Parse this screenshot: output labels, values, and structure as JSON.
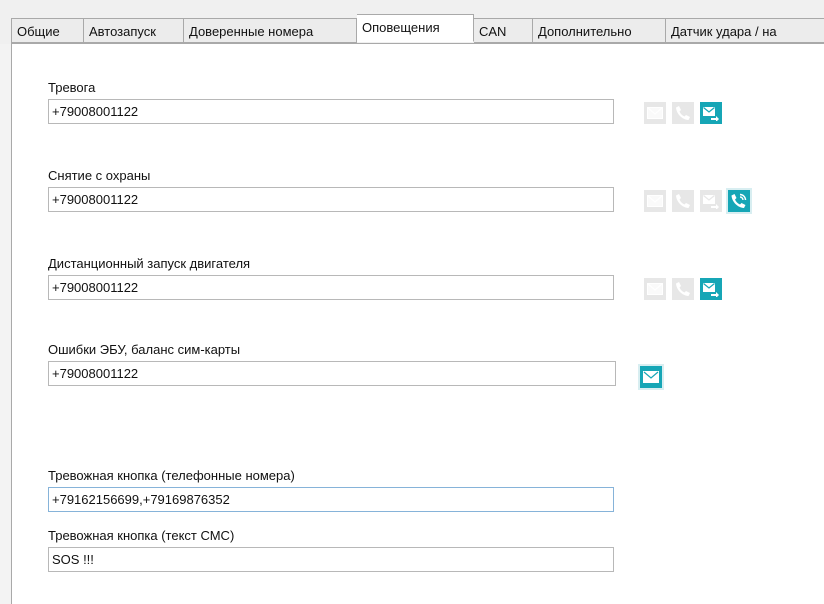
{
  "tabs": [
    {
      "label": "Общие"
    },
    {
      "label": "Автозапуск"
    },
    {
      "label": "Доверенные номера"
    },
    {
      "label": "Оповещения",
      "active": true
    },
    {
      "label": "CAN"
    },
    {
      "label": "Дополнительно"
    },
    {
      "label": "Датчик удара / на"
    }
  ],
  "alerts": [
    {
      "label": "Тревога",
      "value": "+79008001122",
      "icons": [
        "sms-off",
        "call-off",
        "forward-on"
      ]
    },
    {
      "label": "Снятие с охраны",
      "value": "+79008001122",
      "icons": [
        "sms-off",
        "call-off",
        "forward-off",
        "call-ring-on"
      ]
    },
    {
      "label": "Дистанционный запуск двигателя",
      "value": "+79008001122",
      "icons": [
        "sms-off",
        "call-off",
        "forward-on"
      ]
    },
    {
      "label": "Ошибки ЭБУ, баланс сим-карты",
      "value": "+79008001122",
      "icons": [
        "sms-on"
      ]
    }
  ],
  "panic": {
    "phones_label": "Тревожная кнопка (телефонные номера)",
    "phones_value": "+79162156699,+79169876352",
    "sms_label": "Тревожная кнопка (текст СМС)",
    "sms_value": "SOS !!!"
  },
  "colors": {
    "accent": "#16a6b6",
    "disabled": "#e7e7e7"
  }
}
